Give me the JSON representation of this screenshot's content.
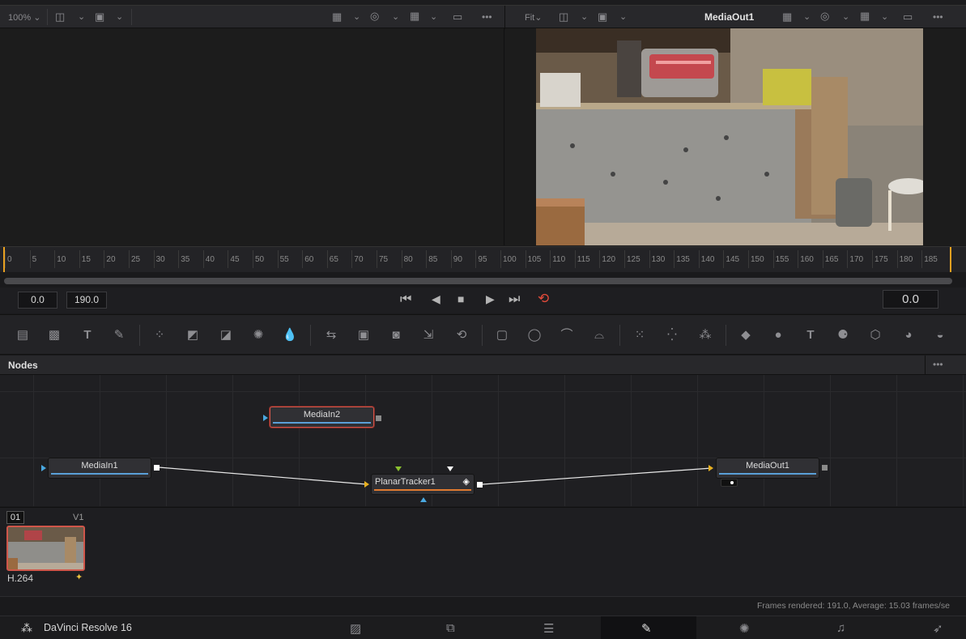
{
  "viewer_left": {
    "zoom": "100%",
    "more": "•••"
  },
  "viewer_right": {
    "fit": "Fit",
    "title": "MediaOut1",
    "more": "•••"
  },
  "ruler": {
    "ticks": [
      "0",
      "5",
      "10",
      "15",
      "20",
      "25",
      "30",
      "35",
      "40",
      "45",
      "50",
      "55",
      "60",
      "65",
      "70",
      "75",
      "80",
      "85",
      "90",
      "95",
      "100",
      "105",
      "110",
      "115",
      "120",
      "125",
      "130",
      "135",
      "140",
      "145",
      "150",
      "155",
      "160",
      "165",
      "170",
      "175",
      "180",
      "185"
    ]
  },
  "transport": {
    "start": "0.0",
    "end": "190.0",
    "current": "0.0"
  },
  "nodes_panel": {
    "title": "Nodes",
    "more": "•••",
    "nodes": {
      "media_in2": "MediaIn2",
      "media_in1": "MediaIn1",
      "planar_tracker": "PlanarTracker1",
      "media_out": "MediaOut1"
    }
  },
  "clips": {
    "index": "01",
    "track": "V1",
    "codec": "H.264"
  },
  "status": {
    "text": "Frames rendered: 191.0,  Average: 15.03 frames/se"
  },
  "app": {
    "name": "DaVinci Resolve 16"
  },
  "colors": {
    "selection": "#d0564a",
    "input_link": "#5aa0d8",
    "tracker_stripe": "#e07a30",
    "loop_icon": "#e04a3a"
  }
}
